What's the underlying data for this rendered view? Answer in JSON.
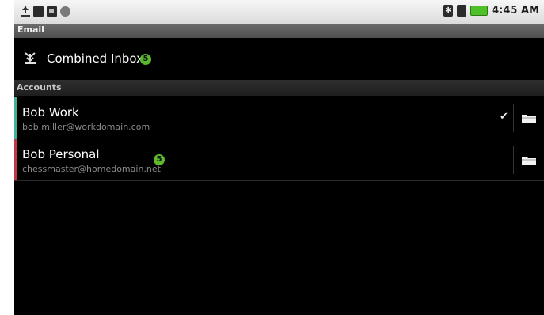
{
  "status_bar": {
    "time": "4:45 AM",
    "left_icons": [
      "upload-icon",
      "notification-icon",
      "sync-icon",
      "dot-icon"
    ],
    "right_icons": [
      "bluetooth-icon",
      "signal-icon",
      "battery-icon"
    ],
    "battery_color": "#4fbf2a"
  },
  "app": {
    "title": "Email"
  },
  "combined_inbox": {
    "label": "Combined Inbox",
    "unread_count": "5"
  },
  "accounts_section": {
    "header": "Accounts",
    "items": [
      {
        "name": "Bob Work",
        "email": "bob.miller@workdomain.com",
        "color": "#3fb29a",
        "selected": true,
        "unread_count": null
      },
      {
        "name": "Bob Personal",
        "email": "chessmaster@homedomain.net",
        "color": "#c2364c",
        "selected": false,
        "unread_count": "5"
      }
    ]
  },
  "colors": {
    "badge": "#5cb82c",
    "background": "#000000"
  }
}
